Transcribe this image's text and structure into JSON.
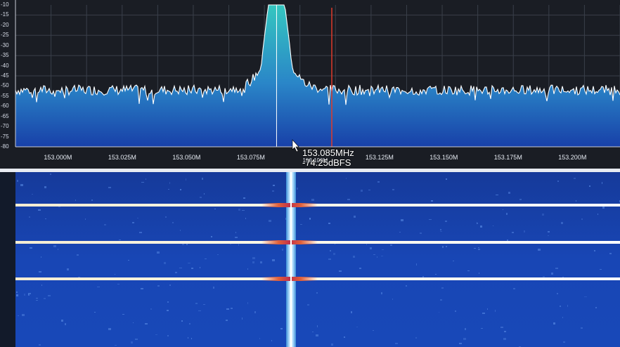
{
  "spectrum": {
    "y_ticks": [
      "-10",
      "-15",
      "-20",
      "-25",
      "-30",
      "-35",
      "-40",
      "-45",
      "-50",
      "-55",
      "-60",
      "-65",
      "-70",
      "-75",
      "-80"
    ],
    "y_range": [
      -80,
      -10
    ],
    "x_ticks": [
      "153.000M",
      "153.025M",
      "153.050M",
      "153.075M",
      "153.100M",
      "153.125M",
      "153.150M",
      "153.175M",
      "153.200M"
    ],
    "x_tick_values": [
      153.0,
      153.025,
      153.05,
      153.075,
      153.1,
      153.125,
      153.15,
      153.175,
      153.2
    ],
    "noise_floor_db": -52,
    "signal_center_mhz": 153.085,
    "signal_peak_db": -10,
    "colors": {
      "background": "#1a1d24",
      "grid": "#3a3f4a",
      "trace": "#ffffff",
      "fill_top": "#35c6c0",
      "fill_bottom": "#1840a8",
      "marker": "#e03a2a"
    }
  },
  "cursor": {
    "frequency": "153.085MHz",
    "level": "-74.25dBFS"
  },
  "waterfall": {
    "icon": "waterfall-display",
    "colors": {
      "background": "#1848b8",
      "signal": "#ffffff",
      "burst": "#c0304a"
    }
  }
}
